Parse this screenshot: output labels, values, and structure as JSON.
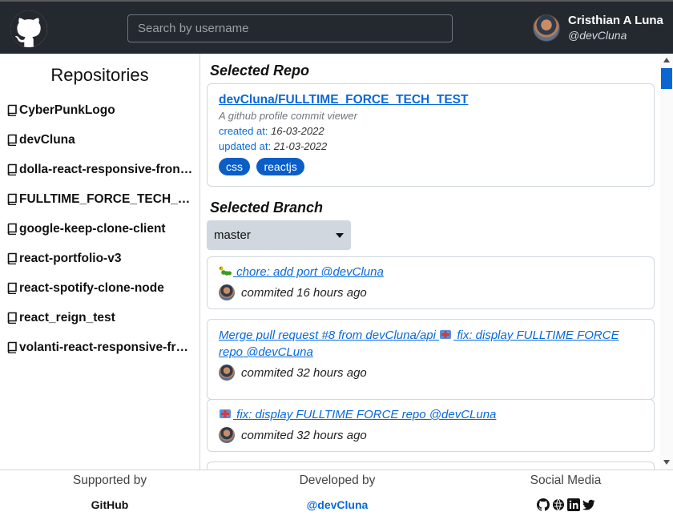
{
  "header": {
    "search_placeholder": "Search by username",
    "user_name": "Cristhian A Luna",
    "user_handle": "@devCluna"
  },
  "sidebar": {
    "title": "Repositories",
    "items": [
      {
        "label": "CyberPunkLogo"
      },
      {
        "label": "devCluna"
      },
      {
        "label": "dolla-react-responsive-front…"
      },
      {
        "label": "FULLTIME_FORCE_TECH_TEST"
      },
      {
        "label": "google-keep-clone-client"
      },
      {
        "label": "react-portfolio-v3"
      },
      {
        "label": "react-spotify-clone-node"
      },
      {
        "label": "react_reign_test"
      },
      {
        "label": "volanti-react-responsive-fro…"
      }
    ]
  },
  "selected_repo": {
    "section_title": "Selected Repo",
    "full_name": "devCluna/FULLTIME_FORCE_TECH_TEST",
    "description": "A github profile commit viewer",
    "created_label": "created at:",
    "created_value": "16-03-2022",
    "updated_label": "updated at:",
    "updated_value": "21-03-2022",
    "tags": [
      "css",
      "reactjs"
    ]
  },
  "selected_branch": {
    "section_title": "Selected Branch",
    "branch_value": "master"
  },
  "commits": [
    {
      "message": " chore: add port @devCluna",
      "meta": "commited 16 hours ago",
      "emoji": "caterpillar-icon"
    },
    {
      "message": "Merge pull request #8 from devCluna/api  fix: display FULLTIME FORCE repo @devCLuna",
      "message_a": "Merge pull request #8 from devCluna/api ",
      "message_b": " fix: display FULLTIME FORCE repo @devCLuna",
      "meta": "commited 32 hours ago",
      "emoji": "ambulance-icon"
    },
    {
      "message": " fix: display FULLTIME FORCE repo @devCLuna",
      "meta": "commited 32 hours ago",
      "emoji": "ambulance-icon"
    }
  ],
  "footer": {
    "supported_heading": "Supported by",
    "supported_value": "GitHub",
    "developed_heading": "Developed by",
    "developed_value": "@devCluna",
    "social_heading": "Social Media",
    "social_icons": [
      "github-icon",
      "globe-icon",
      "linkedin-icon",
      "twitter-icon"
    ]
  },
  "colors": {
    "header_bg": "#24292f",
    "link": "#0969da",
    "tag_bg": "#0a5ec7",
    "scroll_thumb": "#0a66d2"
  }
}
